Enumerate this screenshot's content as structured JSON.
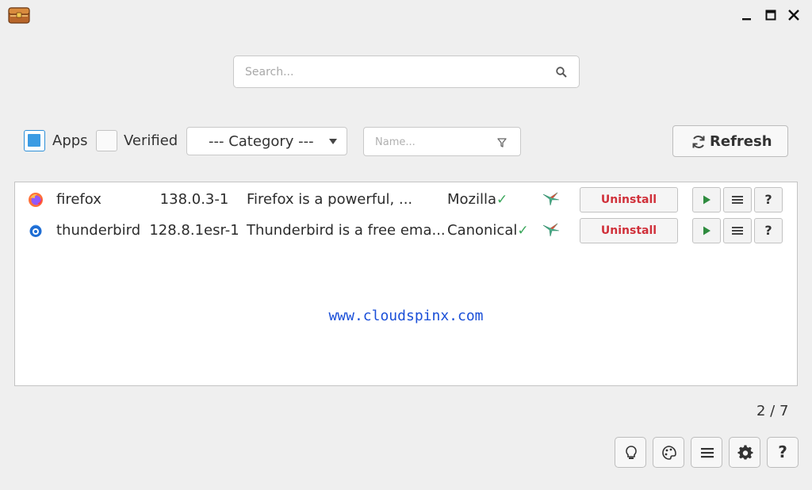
{
  "titlebar": {
    "app_icon": "treasure-chest-icon",
    "minimize": "▁",
    "maximize": "▢",
    "close": "✕"
  },
  "search": {
    "placeholder": "Search..."
  },
  "filters": {
    "apps_label": "Apps",
    "apps_checked": true,
    "verified_label": "Verified",
    "verified_checked": false,
    "category_value": "--- Category ---",
    "name_placeholder": "Name...",
    "refresh_label": "Refresh"
  },
  "apps": [
    {
      "icon": "firefox-icon",
      "name": "firefox",
      "version": "138.0.3-1",
      "description": "Firefox is a powerful, ...",
      "publisher": "Mozilla",
      "verified_mark": "✓",
      "uninstall_label": "Uninstall",
      "help_label": "?"
    },
    {
      "icon": "thunderbird-icon",
      "name": "thunderbird",
      "version": "128.8.1esr-1",
      "description": "Thunderbird is a free ema...",
      "publisher": "Canonical",
      "verified_mark": "✓",
      "uninstall_label": "Uninstall",
      "help_label": "?"
    }
  ],
  "watermark": "www.cloudspinx.com",
  "counter": "2 / 7",
  "bottom_toolbar": {
    "help_label": "?"
  },
  "colors": {
    "accent": "#3b9be3",
    "uninstall_text": "#d0303a",
    "verified_check": "#3aa65a",
    "play": "#2e8b3e",
    "watermark": "#1a4fd8"
  }
}
